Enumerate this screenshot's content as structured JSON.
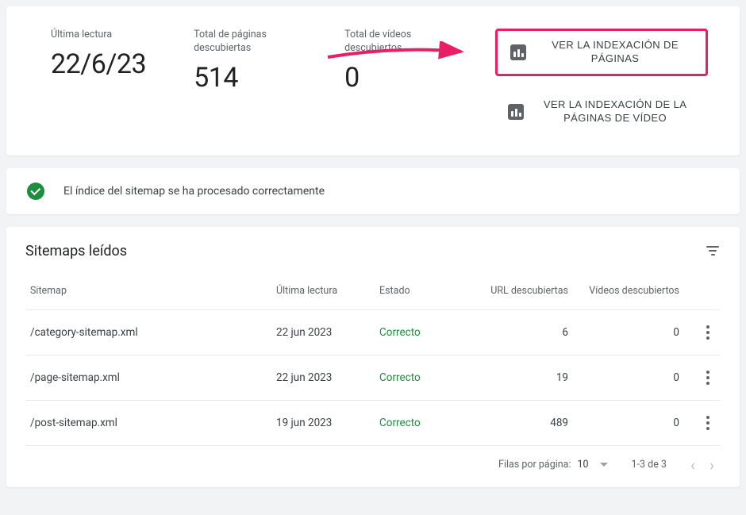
{
  "summary": {
    "last_read_label": "Última lectura",
    "last_read_value": "22/6/23",
    "pages_label": "Total de páginas descubiertas",
    "pages_value": "514",
    "videos_label": "Total de vídeos descubiertos",
    "videos_value": "0",
    "action_pages": "VER LA INDEXACIÓN DE PÁGINAS",
    "action_videos": "VER LA INDEXACIÓN DE LA PÁGINAS DE VÍDEO"
  },
  "status": {
    "message": "El índice del sitemap se ha procesado correctamente"
  },
  "table": {
    "title": "Sitemaps leídos",
    "headers": {
      "sitemap": "Sitemap",
      "last_read": "Última lectura",
      "state": "Estado",
      "urls": "URL descubiertas",
      "videos": "Vídeos descubiertos"
    },
    "rows": [
      {
        "sitemap": "/category-sitemap.xml",
        "last_read": "22 jun 2023",
        "state": "Correcto",
        "urls": "6",
        "videos": "0"
      },
      {
        "sitemap": "/page-sitemap.xml",
        "last_read": "22 jun 2023",
        "state": "Correcto",
        "urls": "19",
        "videos": "0"
      },
      {
        "sitemap": "/post-sitemap.xml",
        "last_read": "19 jun 2023",
        "state": "Correcto",
        "urls": "489",
        "videos": "0"
      }
    ]
  },
  "pagination": {
    "label": "Filas por página:",
    "per_page": "10",
    "range": "1-3 de 3"
  }
}
